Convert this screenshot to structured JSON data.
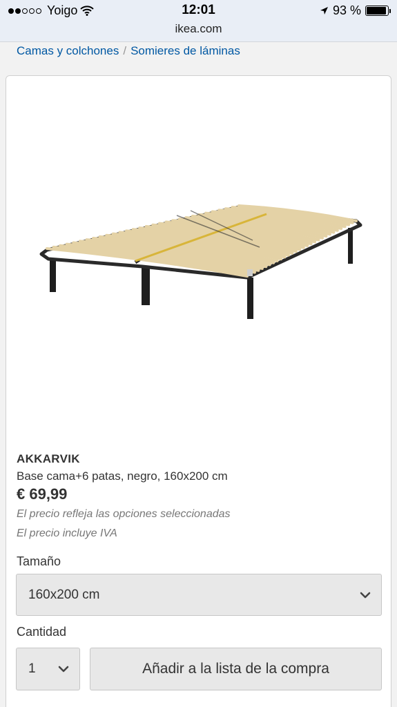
{
  "status_bar": {
    "carrier": "Yoigo",
    "time": "12:01",
    "battery_percent": "93 %",
    "battery_level": 0.93,
    "signal_bars": 2
  },
  "browser": {
    "url": "ikea.com"
  },
  "breadcrumb": {
    "items": [
      "Camas y colchones",
      "Somieres de láminas"
    ],
    "separator": "/"
  },
  "product": {
    "name": "AKKARVIK",
    "description": "Base cama+6 patas, negro, 160x200 cm",
    "price": "€ 69,99",
    "note_options": "El precio refleja las opciones seleccionadas",
    "note_vat": "El precio incluye IVA"
  },
  "size": {
    "label": "Tamaño",
    "selected": "160x200 cm"
  },
  "quantity": {
    "label": "Cantidad",
    "selected": "1"
  },
  "add_button": {
    "label": "Añadir a la lista de la compra"
  },
  "colors": {
    "link": "#0058a3",
    "control_bg": "#e8e8e8"
  },
  "icons": [
    "wifi-icon",
    "location-arrow-icon",
    "battery-icon",
    "chevron-down-icon"
  ]
}
